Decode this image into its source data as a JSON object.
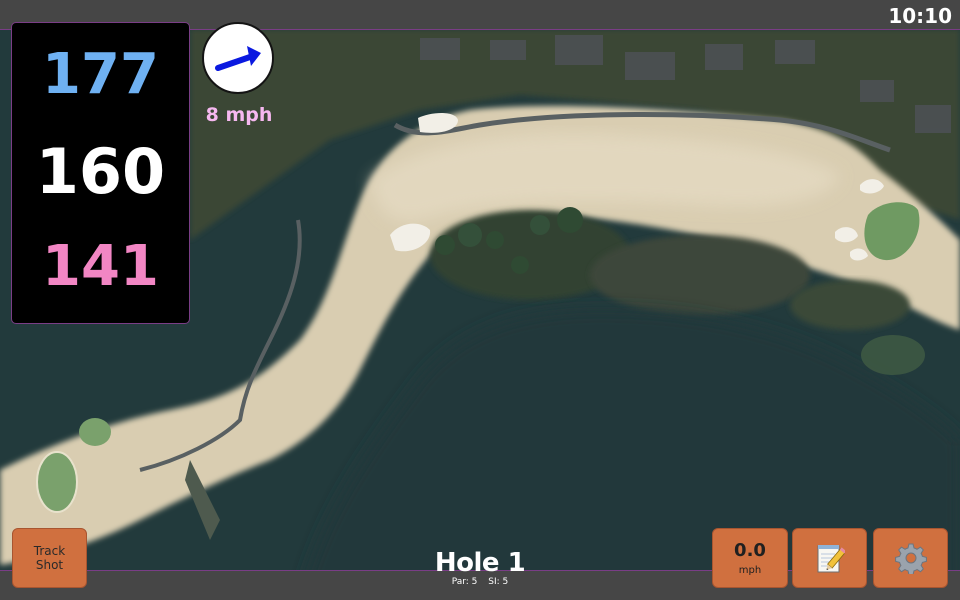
{
  "status_bar": {
    "clock": "10:10"
  },
  "distances": {
    "back": "177",
    "middle": "160",
    "front": "141",
    "colors": {
      "back": "#6fb1f2",
      "middle": "#ffffff",
      "front": "#f286c4"
    }
  },
  "wind": {
    "speed": "8 mph",
    "direction_icon": "arrow-northeast-icon",
    "arrow_color": "#0a19e0"
  },
  "buttons": {
    "track_shot_line1": "Track",
    "track_shot_line2": "Shot",
    "speed_value": "0.0",
    "speed_unit": "mph",
    "notes_icon": "notepad-pencil-icon",
    "settings_icon": "gear-icon",
    "accent_color": "#d0703f"
  },
  "hole": {
    "title": "Hole 1",
    "par": "Par: 5",
    "stroke_index": "SI: 5"
  },
  "theme": {
    "bar_color": "#464646",
    "border_accent": "#7a3d86",
    "fairway_color": "#d9cdb1",
    "water_color": "#223a3c",
    "green_color": "#6f9a62"
  }
}
